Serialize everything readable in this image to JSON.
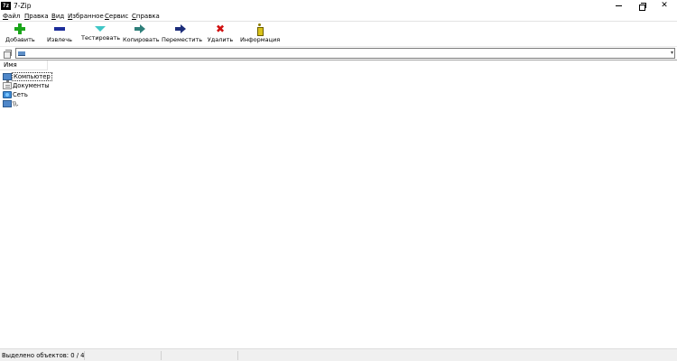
{
  "window": {
    "app_icon_text": "7z",
    "title": "7-Zip",
    "minimize_glyph": "—",
    "close_glyph": "✕"
  },
  "menu": {
    "items": [
      {
        "hotkey": "Ф",
        "rest": "айл"
      },
      {
        "hotkey": "П",
        "rest": "равка"
      },
      {
        "hotkey": "В",
        "rest": "ид"
      },
      {
        "hotkey": "И",
        "rest": "збранное"
      },
      {
        "hotkey": "С",
        "rest": "ервис"
      },
      {
        "hotkey": "С",
        "rest": "правка"
      }
    ]
  },
  "toolbar": {
    "buttons": [
      {
        "label": "Добавить",
        "icon": "add-icon",
        "color": "#1aa51a"
      },
      {
        "label": "Извлечь",
        "icon": "extract-icon",
        "color": "#1c2d9a"
      },
      {
        "label": "Тестировать",
        "icon": "test-icon",
        "color": "#3fc6c6"
      },
      {
        "label": "Копировать",
        "icon": "copy-icon",
        "color": "#2f7f7a"
      },
      {
        "label": "Переместить",
        "icon": "move-icon",
        "color": "#1c2d7a"
      },
      {
        "label": "Удалить",
        "icon": "delete-icon",
        "color": "#d01010"
      },
      {
        "label": "Информация",
        "icon": "info-icon",
        "color": "#d9c21a"
      }
    ],
    "delete_glyph": "✖"
  },
  "address": {
    "value": "",
    "dropdown_glyph": "▾"
  },
  "file_list": {
    "column_header": "Имя",
    "rows": [
      {
        "label": "Компьютер",
        "icon": "computer-icon",
        "selected": true
      },
      {
        "label": "Документы",
        "icon": "documents-icon",
        "selected": false
      },
      {
        "label": "Сеть",
        "icon": "network-icon",
        "selected": false
      },
      {
        "label": "\\\\.",
        "icon": "network-computer-icon",
        "selected": false
      }
    ]
  },
  "status": {
    "text": "Выделено объектов: 0 / 4"
  }
}
